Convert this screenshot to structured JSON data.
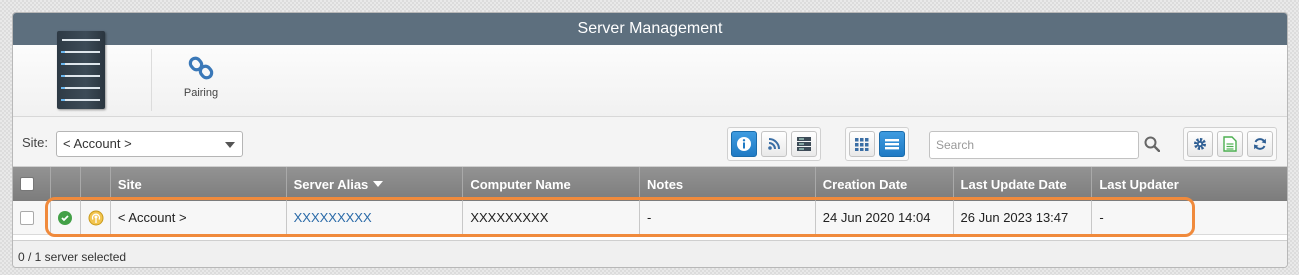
{
  "title": "Server Management",
  "ribbon": {
    "pairing_label": "Pairing"
  },
  "filter": {
    "site_label": "Site:",
    "site_value": "< Account >",
    "search_placeholder": "Search"
  },
  "toolbar": {
    "view_buttons": [
      "info-icon",
      "rss-icon",
      "server-list-icon"
    ],
    "layout_buttons": [
      "grid-view-icon",
      "list-view-icon"
    ],
    "action_buttons": [
      "gear-icon",
      "export-document-icon",
      "refresh-icon"
    ],
    "accent": "#1f7ac4"
  },
  "table": {
    "columns": [
      "Site",
      "Server Alias",
      "Computer Name",
      "Notes",
      "Creation Date",
      "Last Update Date",
      "Last Updater"
    ],
    "sorted_column": "Server Alias",
    "rows": [
      {
        "site": "< Account >",
        "server_alias": "XXXXXXXXX",
        "computer_name": "XXXXXXXXX",
        "notes": "-",
        "creation_date": "24 Jun 2020 14:04",
        "last_update_date": "26 Jun 2023 13:47",
        "last_updater": "-",
        "status": "online",
        "status_color": "#43a047",
        "agent_icon": "broadcast-icon"
      }
    ]
  },
  "footer": {
    "selection_text": "0 / 1 server selected"
  },
  "highlight_color": "#f08a3c"
}
